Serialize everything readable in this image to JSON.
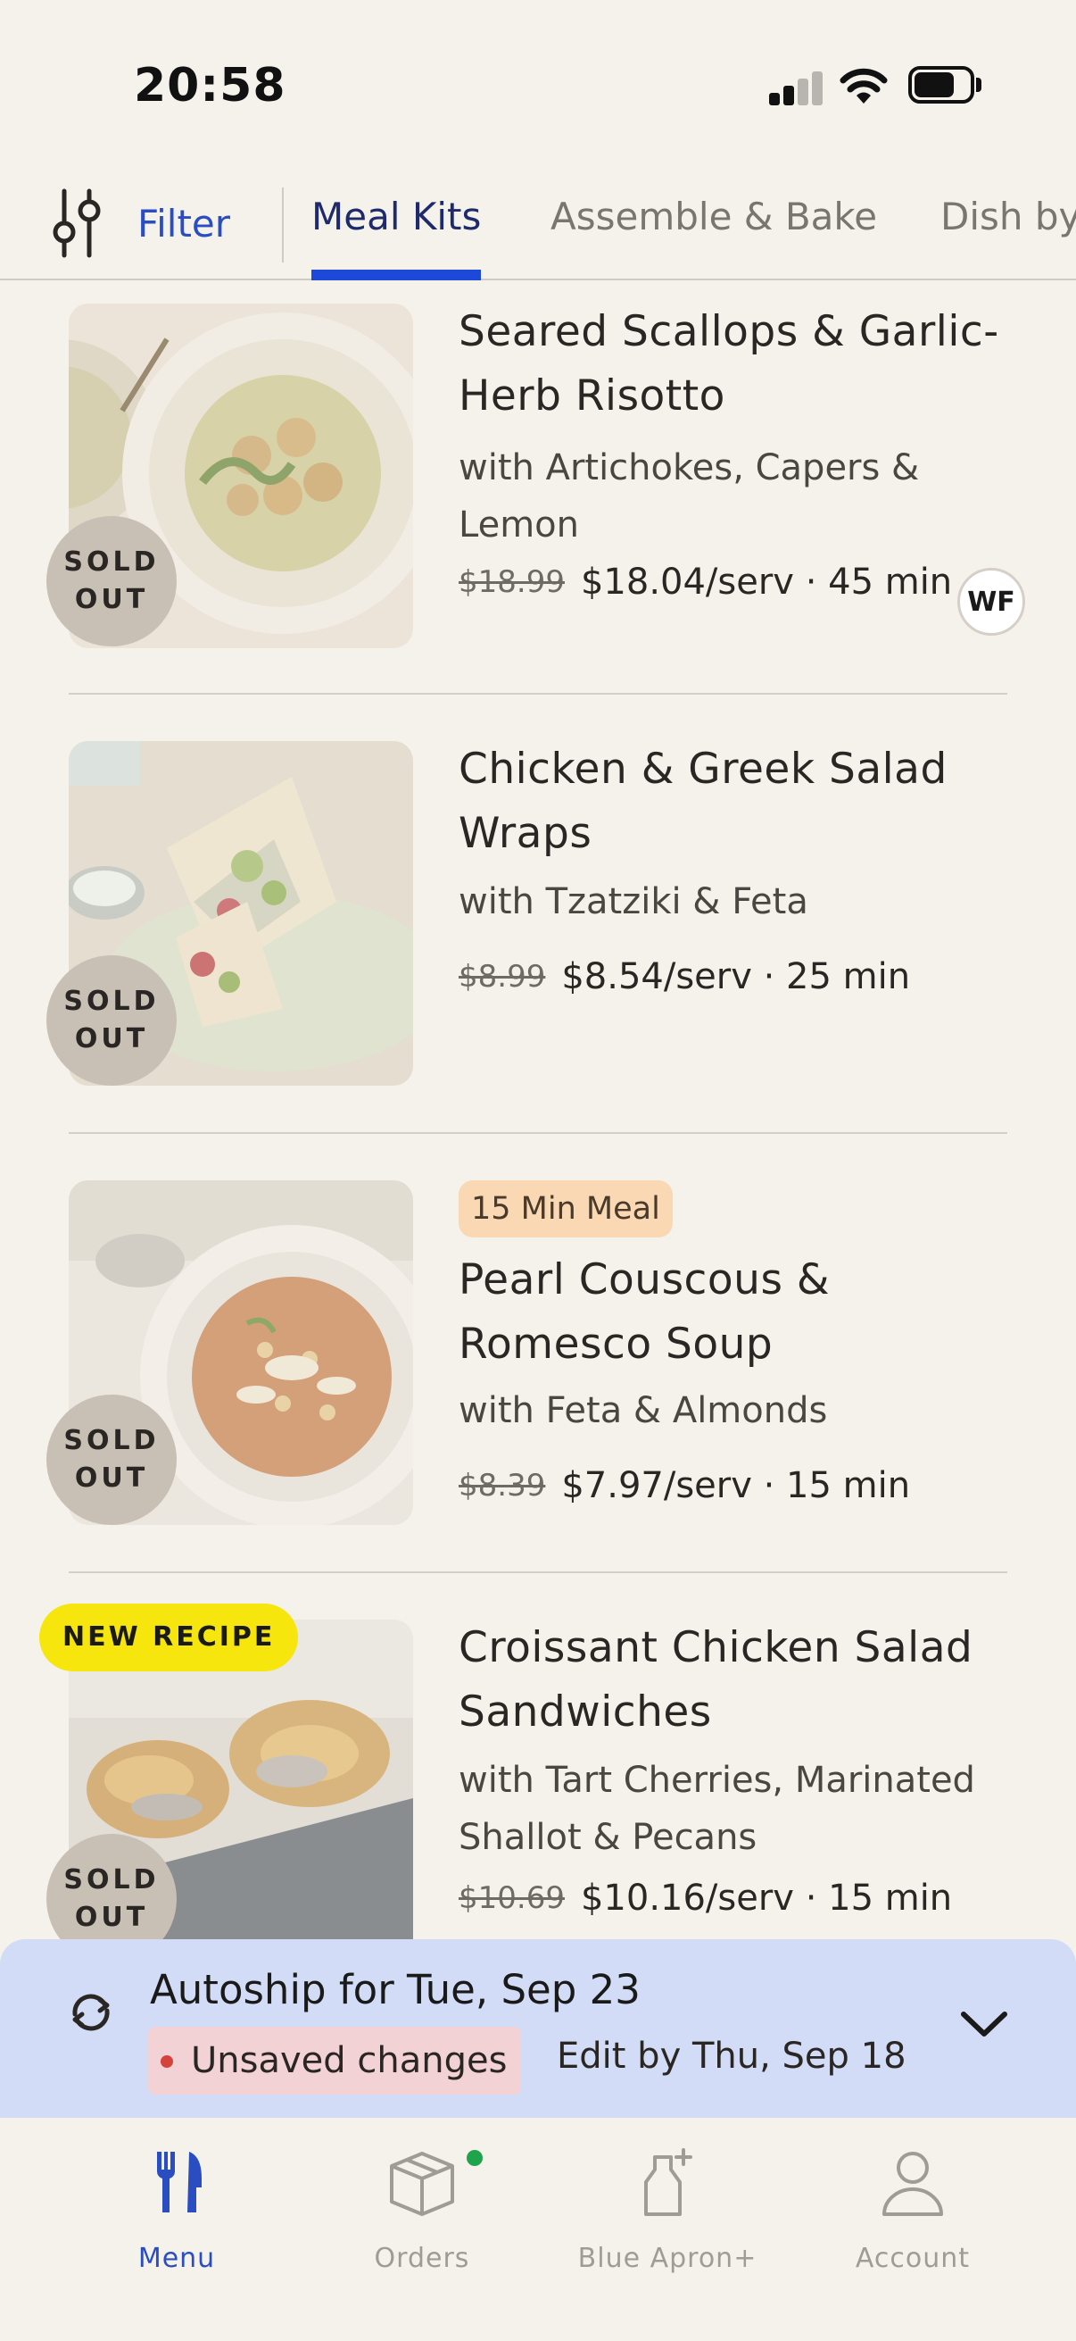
{
  "status_bar": {
    "time": "20:58"
  },
  "tabs": {
    "filter_label": "Filter",
    "items": [
      {
        "label": "Meal Kits",
        "active": true
      },
      {
        "label": "Assemble & Bake",
        "active": false
      },
      {
        "label": "Dish by",
        "active": false
      }
    ]
  },
  "recipes": [
    {
      "title_lines": [
        "Seared Scallops & Garlic-",
        "Herb Risotto"
      ],
      "subtitle_lines": [
        "with Artichokes, Capers &",
        "Lemon"
      ],
      "old_price": "$18.99",
      "price": "$18.04/serv · 45 min",
      "sold_out": [
        "SOLD",
        "OUT"
      ],
      "tag": "WF"
    },
    {
      "title_lines": [
        "Chicken & Greek Salad",
        "Wraps"
      ],
      "subtitle_lines": [
        "with Tzatziki & Feta"
      ],
      "old_price": "$8.99",
      "price": "$8.54/serv · 25 min",
      "sold_out": [
        "SOLD",
        "OUT"
      ]
    },
    {
      "badge": "15 Min Meal",
      "title_lines": [
        "Pearl Couscous &",
        "Romesco Soup"
      ],
      "subtitle_lines": [
        "with Feta & Almonds"
      ],
      "old_price": "$8.39",
      "price": "$7.97/serv · 15 min",
      "sold_out": [
        "SOLD",
        "OUT"
      ]
    },
    {
      "new_badge": "NEW RECIPE",
      "title_lines": [
        "Croissant Chicken Salad",
        "Sandwiches"
      ],
      "subtitle_lines": [
        "with Tart Cherries, Marinated",
        "Shallot & Pecans"
      ],
      "old_price": "$10.69",
      "price": "$10.16/serv · 15 min",
      "sold_out": [
        "SOLD",
        "OUT"
      ]
    }
  ],
  "autoship": {
    "title": "Autoship for Tue, Sep 23",
    "unsaved": "Unsaved changes",
    "edit_by": "Edit by Thu, Sep 18"
  },
  "bottom_nav": [
    {
      "label": "Menu",
      "icon": "fork-knife-icon",
      "active": true
    },
    {
      "label": "Orders",
      "icon": "box-icon",
      "active": false,
      "notification": true
    },
    {
      "label": "Blue Apron+",
      "icon": "bottle-plus-icon",
      "active": false
    },
    {
      "label": "Account",
      "icon": "person-icon",
      "active": false
    }
  ],
  "colors": {
    "accent": "#2a4ec2",
    "tab_underline": "#1d48d8",
    "background": "#f5f2ec",
    "autoship_bg": "#d3dcf6",
    "new_badge": "#f6e60e",
    "meal_badge": "#fad8b4"
  }
}
